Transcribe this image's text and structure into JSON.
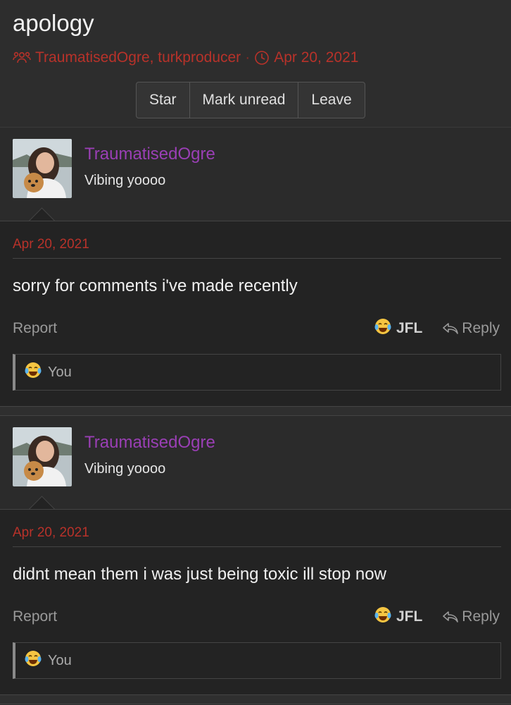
{
  "thread": {
    "title": "apology",
    "participants": "TraumatisedOgre, turkproducer",
    "separator": "·",
    "date": "Apr 20, 2021"
  },
  "buttons": {
    "star": "Star",
    "mark_unread": "Mark unread",
    "leave": "Leave"
  },
  "colors": {
    "accent_red": "#b8322a",
    "username_purple": "#9a3fb5"
  },
  "posts": [
    {
      "username": "TraumatisedOgre",
      "user_title": "Vibing yoooo",
      "date": "Apr 20, 2021",
      "message": "sorry for comments i've made recently",
      "report": "Report",
      "reaction_label": "JFL",
      "reply": "Reply",
      "reacted_by": "You"
    },
    {
      "username": "TraumatisedOgre",
      "user_title": "Vibing yoooo",
      "date": "Apr 20, 2021",
      "message": "didnt mean them i was just being toxic ill stop now",
      "report": "Report",
      "reaction_label": "JFL",
      "reply": "Reply",
      "reacted_by": "You"
    }
  ]
}
